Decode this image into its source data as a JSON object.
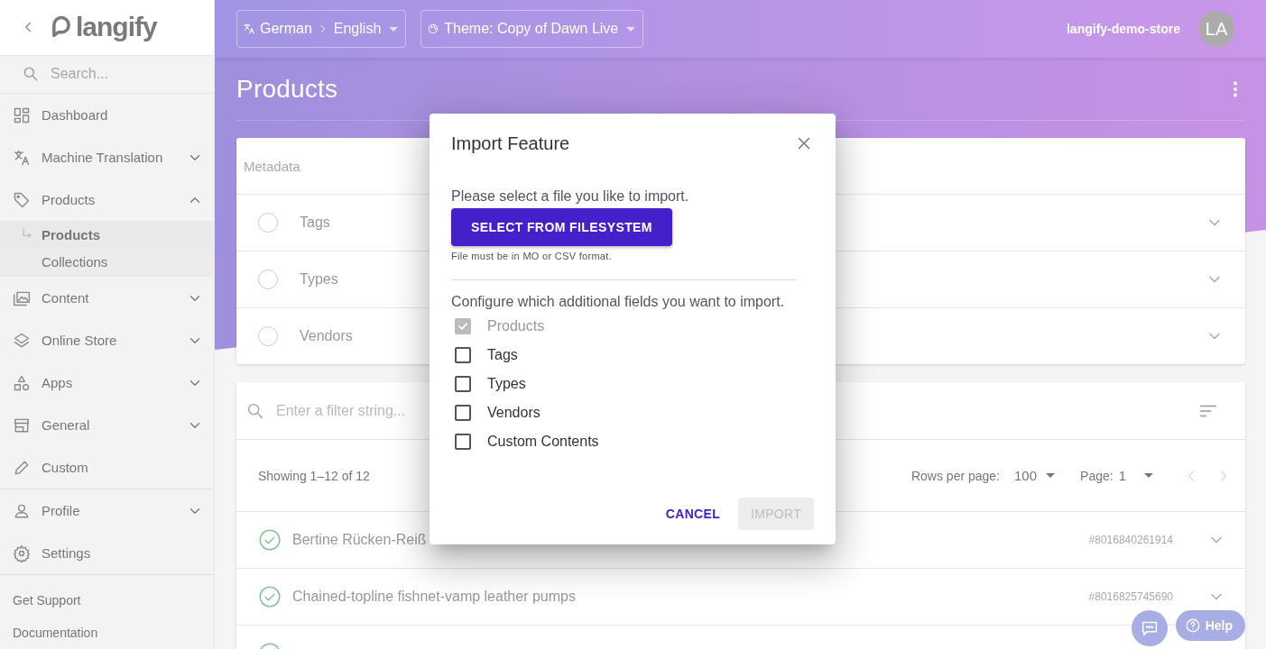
{
  "sidebar": {
    "logo": "langify",
    "search": {
      "placeholder": "Search..."
    },
    "sections": [
      [
        {
          "kind": "link",
          "label": "Dashboard"
        },
        {
          "kind": "group",
          "label": "Machine Translation",
          "expanded": false
        },
        {
          "kind": "group",
          "label": "Products",
          "expanded": true,
          "children": [
            {
              "label": "Products",
              "selected": true
            },
            {
              "label": "Collections",
              "selected": false
            }
          ]
        },
        {
          "kind": "group",
          "label": "Content",
          "expanded": false
        },
        {
          "kind": "group",
          "label": "Online Store",
          "expanded": false
        },
        {
          "kind": "group",
          "label": "Apps",
          "expanded": false
        },
        {
          "kind": "group",
          "label": "General",
          "expanded": false
        },
        {
          "kind": "link",
          "label": "Custom"
        }
      ],
      [
        {
          "kind": "group",
          "label": "Profile",
          "expanded": false
        },
        {
          "kind": "link",
          "label": "Settings"
        }
      ]
    ],
    "footer_links": [
      "Get Support",
      "Documentation"
    ]
  },
  "topbar": {
    "language": {
      "source": "German",
      "target": "English"
    },
    "theme": "Theme: Copy of Dawn Live",
    "store": "langify-demo-store",
    "avatar": "LA"
  },
  "page": {
    "title": "Products"
  },
  "metadata": {
    "label": "Metadata",
    "rows": [
      {
        "label": "Tags",
        "checked": false
      },
      {
        "label": "Types",
        "checked": false
      },
      {
        "label": "Vendors",
        "checked": false
      }
    ]
  },
  "list": {
    "filter": {
      "placeholder": "Enter a filter string..."
    },
    "showing": "Showing 1–12 of 12",
    "rows_per_page": {
      "label": "Rows per page:",
      "value": "100"
    },
    "page": {
      "label": "Page:",
      "value": "1"
    },
    "rows": [
      {
        "title": "Bertine Rücken-Reiß",
        "id": "#8016840261914",
        "checked": true
      },
      {
        "title": "Chained-topline fishnet-vamp leather pumps",
        "id": "#8016825745690",
        "checked": true
      },
      {
        "checked": true
      }
    ]
  },
  "dialog": {
    "title": "Import Feature",
    "prompt": "Please select a file you like to import.",
    "select_button": "SELECT FROM FILESYSTEM",
    "hint": "File must be in MO or CSV format.",
    "config_prompt": "Configure which additional fields you want to import.",
    "options": [
      {
        "label": "Products",
        "checked": true,
        "disabled": true
      },
      {
        "label": "Tags",
        "checked": false,
        "disabled": false
      },
      {
        "label": "Types",
        "checked": false,
        "disabled": false
      },
      {
        "label": "Vendors",
        "checked": false,
        "disabled": false
      },
      {
        "label": "Custom Contents",
        "checked": false,
        "disabled": false
      }
    ],
    "cancel": "CANCEL",
    "import": {
      "label": "IMPORT",
      "disabled": true
    }
  },
  "help": {
    "label": "Help"
  }
}
